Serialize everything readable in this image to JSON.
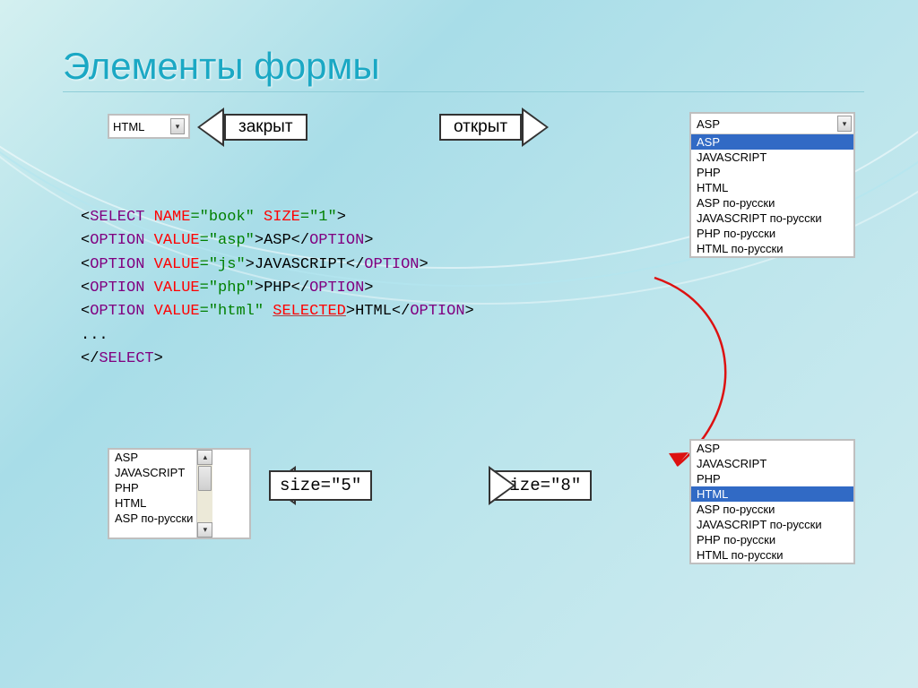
{
  "title": "Элементы формы",
  "labels": {
    "closed": "закрыт",
    "open": "открыт",
    "size5": "size=\"5\"",
    "size8": "size=\"8\""
  },
  "dropdown_closed_value": "HTML",
  "dropdown_open_head": "ASP",
  "options_full": [
    "ASP",
    "JAVASCRIPT",
    "PHP",
    "HTML",
    "ASP по-русски",
    "JAVASCRIPT по-русски",
    "PHP по-русски",
    "HTML по-русски"
  ],
  "selected_open_index": 0,
  "selected_size8_index": 3,
  "listbox5_visible": [
    "ASP",
    "JAVASCRIPT",
    "PHP",
    "HTML",
    "ASP по-русски"
  ],
  "code": {
    "l1": {
      "pre": "<",
      "tag": "select",
      "a1": " name",
      "v1": "=\"book\"",
      "a2": " size",
      "v2": "=\"1\"",
      "post": ">"
    },
    "l2": {
      "pre": "  <",
      "tag": "option",
      "a1": " value",
      "v1": "=\"asp\"",
      "post1": ">",
      "txt": "ASP",
      "close": "</",
      "tag2": "option",
      "post2": ">"
    },
    "l3": {
      "pre": "   <",
      "tag": "option",
      "a1": " value",
      "v1": "=\"js\"",
      "post1": ">",
      "txt": "JAVASCRIPT",
      "close": "</",
      "tag2": "option",
      "post2": ">"
    },
    "l4": {
      "pre": "  <",
      "tag": "option",
      "a1": " value",
      "v1": "=\"php\"",
      "post1": ">",
      "txt": "PHP",
      "close": "</",
      "tag2": "option",
      "post2": ">"
    },
    "l5": {
      "pre": "  <",
      "tag": "option",
      "a1": " value",
      "v1": "=\"html\" ",
      "sel": "selected",
      "post1": ">",
      "txt": "HTML",
      "close": "</",
      "tag2": "option",
      "post2": ">"
    },
    "l6": "  ...",
    "l7": {
      "pre": "</",
      "tag": "select",
      "post": ">"
    }
  }
}
